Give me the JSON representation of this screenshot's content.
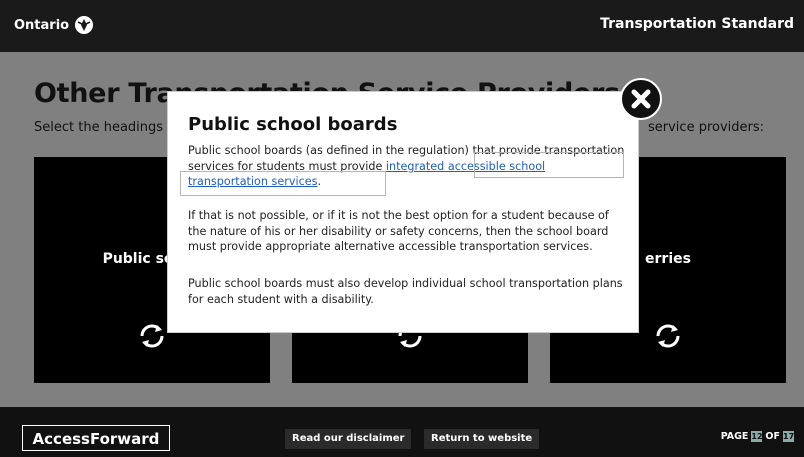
{
  "header": {
    "logo_text": "Ontario",
    "title": "Transportation Standard"
  },
  "main": {
    "heading": "Other Transportation Service Providers",
    "instructions_left": "Select the headings",
    "instructions_right": "service providers:",
    "cards": [
      {
        "label": "Public schoo",
        "icon": "refresh-icon"
      },
      {
        "label": "",
        "icon": "refresh-icon"
      },
      {
        "label": "erries",
        "icon": "refresh-icon"
      }
    ]
  },
  "modal": {
    "title": "Public school boards",
    "p1_text": "Public school boards (as defined in the regulation) that provide transportation services for students must provide ",
    "p1_link": "integrated accessible school transportation services",
    "p1_end": ".",
    "p2": "If that is not possible, or if it is not the best option for a student because of the nature of his or her disability or safety concerns, then the school board must provide appropriate alternative accessible transportation services.",
    "p3": "Public school boards must also develop individual school transportation plans for each student with a disability.",
    "close_icon": "close-icon"
  },
  "footer": {
    "brand": "AccessForward",
    "disclaimer_label": "Read our disclaimer",
    "return_label": "Return to website",
    "page_prefix": "PAGE",
    "page_current": "12",
    "page_of": "OF",
    "page_total": "17"
  }
}
